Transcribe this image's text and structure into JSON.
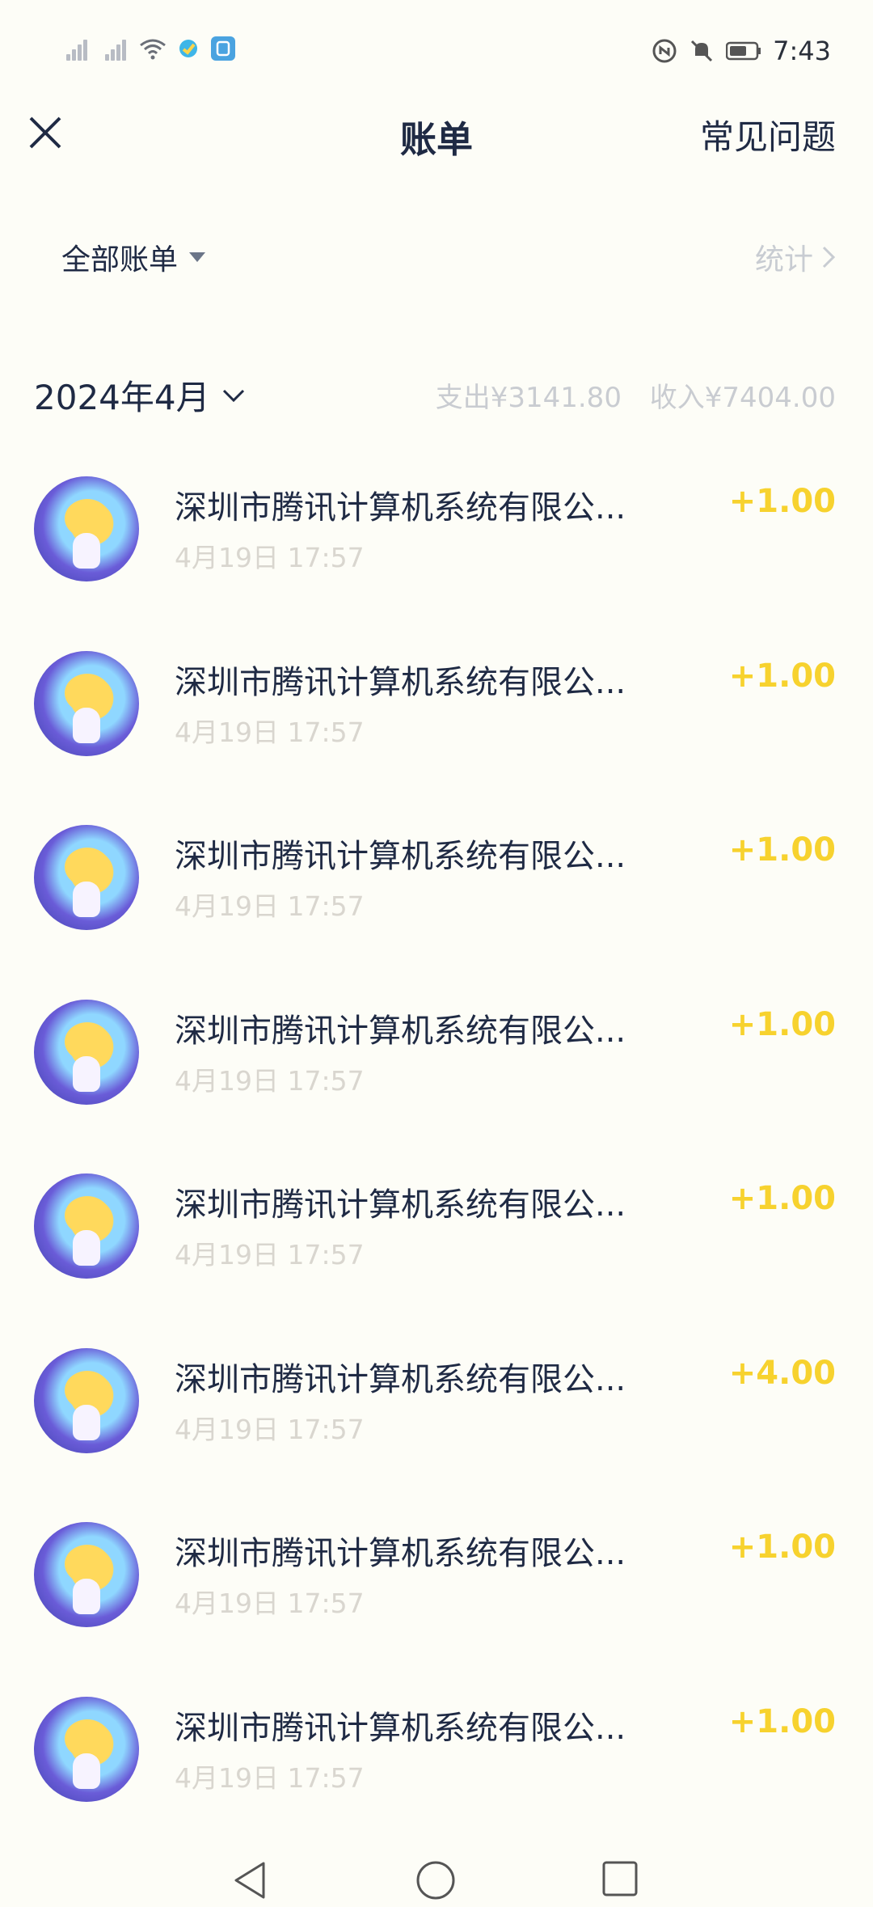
{
  "status": {
    "time": "7:43"
  },
  "header": {
    "title": "账单",
    "faq_label": "常见问题"
  },
  "filter": {
    "label": "全部账单",
    "stats_label": "统计"
  },
  "month": {
    "label": "2024年4月",
    "expense": "支出¥3141.80",
    "income": "收入¥7404.00"
  },
  "transactions": [
    {
      "title": "深圳市腾讯计算机系统有限公...",
      "time": "4月19日 17:57",
      "amount": "+1.00"
    },
    {
      "title": "深圳市腾讯计算机系统有限公...",
      "time": "4月19日 17:57",
      "amount": "+1.00"
    },
    {
      "title": "深圳市腾讯计算机系统有限公...",
      "time": "4月19日 17:57",
      "amount": "+1.00"
    },
    {
      "title": "深圳市腾讯计算机系统有限公...",
      "time": "4月19日 17:57",
      "amount": "+1.00"
    },
    {
      "title": "深圳市腾讯计算机系统有限公...",
      "time": "4月19日 17:57",
      "amount": "+1.00"
    },
    {
      "title": "深圳市腾讯计算机系统有限公...",
      "time": "4月19日 17:57",
      "amount": "+4.00"
    },
    {
      "title": "深圳市腾讯计算机系统有限公...",
      "time": "4月19日 17:57",
      "amount": "+1.00"
    },
    {
      "title": "深圳市腾讯计算机系统有限公...",
      "time": "4月19日 17:57",
      "amount": "+1.00"
    }
  ],
  "colors": {
    "amount": "#f7d22e",
    "title": "#1f2a44",
    "muted": "#c9ccd1",
    "background": "#fdfdf7"
  },
  "icons": [
    "signal-icon",
    "wifi-icon",
    "app-notify-icon",
    "nfc-icon",
    "mute-icon",
    "battery-icon",
    "close-icon",
    "caret-down-icon",
    "chevron-right-icon",
    "chevron-down-icon",
    "back-nav-icon",
    "home-nav-icon",
    "recents-nav-icon"
  ]
}
